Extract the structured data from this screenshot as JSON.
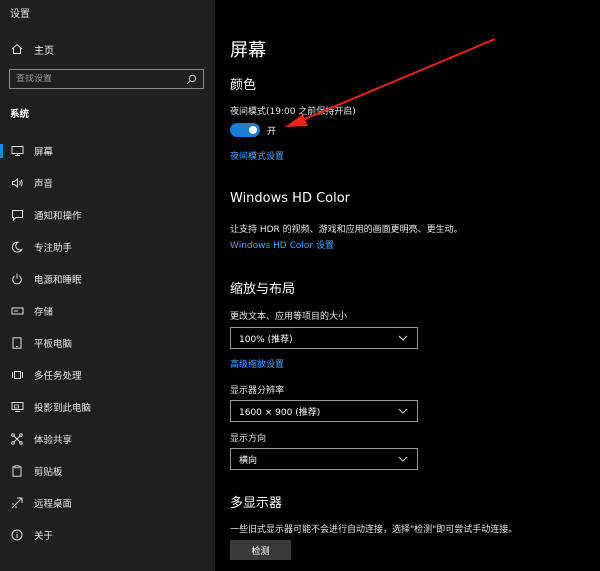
{
  "app": {
    "title": "设置"
  },
  "sidebar": {
    "home_label": "主页",
    "search_placeholder": "查找设置",
    "section_label": "系统",
    "items": [
      {
        "label": "屏幕",
        "icon": "monitor-icon",
        "active": true
      },
      {
        "label": "声音",
        "icon": "speaker-icon"
      },
      {
        "label": "通知和操作",
        "icon": "notification-icon"
      },
      {
        "label": "专注助手",
        "icon": "moon-icon"
      },
      {
        "label": "电源和睡眠",
        "icon": "power-icon"
      },
      {
        "label": "存储",
        "icon": "storage-icon"
      },
      {
        "label": "平板电脑",
        "icon": "tablet-icon"
      },
      {
        "label": "多任务处理",
        "icon": "multitask-icon"
      },
      {
        "label": "投影到此电脑",
        "icon": "project-icon"
      },
      {
        "label": "体验共享",
        "icon": "share-icon"
      },
      {
        "label": "剪贴板",
        "icon": "clipboard-icon"
      },
      {
        "label": "远程桌面",
        "icon": "remote-desktop-icon"
      },
      {
        "label": "关于",
        "icon": "info-icon"
      }
    ]
  },
  "main": {
    "page_title": "屏幕",
    "color": {
      "heading": "颜色",
      "night_light_label": "夜间模式(19:00 之前保持开启)",
      "toggle_state": "开",
      "toggle_on": true,
      "night_light_settings_link": "夜间模式设置"
    },
    "hdr": {
      "heading": "Windows HD Color",
      "description": "让支持 HDR 的视频、游戏和应用的画面更明亮、更生动。",
      "link": "Windows HD Color 设置"
    },
    "scale": {
      "heading": "缩放与布局",
      "scale_label": "更改文本、应用等项目的大小",
      "scale_value": "100% (推荐)",
      "advanced_link": "高级缩放设置",
      "resolution_label": "显示器分辨率",
      "resolution_value": "1600 × 900 (推荐)",
      "orientation_label": "显示方向",
      "orientation_value": "横向"
    },
    "multi": {
      "heading": "多显示器",
      "description": "一些旧式显示器可能不会进行自动连接，选择\"检测\"即可尝试手动连接。",
      "detect_button": "检测"
    }
  },
  "colors": {
    "accent": "#1a7fd4",
    "link": "#4aa3ff",
    "annotation_arrow": "#e8241d"
  }
}
